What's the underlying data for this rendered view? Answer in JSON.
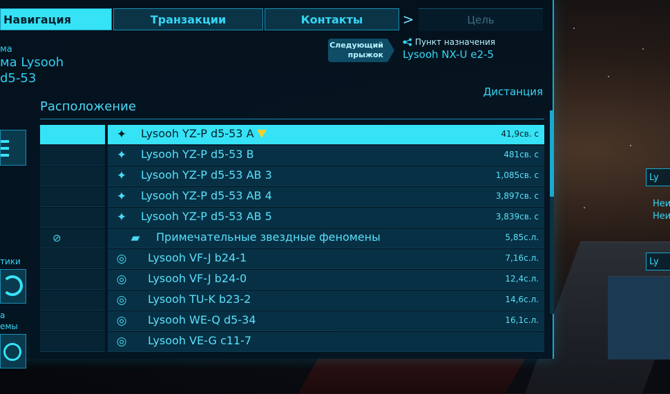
{
  "tabs": {
    "navigation": "Навигация",
    "transactions": "Транзакции",
    "contacts": "Контакты",
    "next_arrow": ">",
    "goal": "Цель"
  },
  "system": {
    "line1": "ма",
    "line2": "ма Lysooh",
    "line3": "d5-53"
  },
  "next_jump": {
    "label_line1": "Следующий",
    "label_line2": "прыжок",
    "dest_title": "Пункт назначения",
    "dest_value": "Lysooh NX-U e2-5"
  },
  "list_header": {
    "location": "Расположение",
    "distance": "Дистанция"
  },
  "left_panel": {
    "label1": "тики",
    "label2": "а",
    "label3": "емы"
  },
  "rows": [
    {
      "icon": "star-icon",
      "name": "Lysooh YZ-P d5-53 A",
      "distance": "41,9св. с",
      "selected": true,
      "marker": true
    },
    {
      "icon": "star-icon",
      "name": "Lysooh YZ-P d5-53 B",
      "distance": "481св. с"
    },
    {
      "icon": "star-icon",
      "name": "Lysooh YZ-P d5-53 AB 3",
      "distance": "1,085св. с"
    },
    {
      "icon": "star-icon",
      "name": "Lysooh YZ-P d5-53 AB 4",
      "distance": "3,897св. с"
    },
    {
      "icon": "star-icon",
      "name": "Lysooh YZ-P d5-53 AB 5",
      "distance": "3,839св. с"
    },
    {
      "icon": "codex-icon",
      "name": "Примечательные звездные феномены",
      "distance": "5,85с.л.",
      "left_icon": true
    },
    {
      "icon": "system-icon",
      "name": "Lysooh VF-J b24-1",
      "distance": "7,16с.л."
    },
    {
      "icon": "system-icon",
      "name": "Lysooh VF-J b24-0",
      "distance": "12,4с.л."
    },
    {
      "icon": "system-icon",
      "name": "Lysooh TU-K b23-2",
      "distance": "14,6с.л."
    },
    {
      "icon": "system-icon",
      "name": "Lysooh WE-Q d5-34",
      "distance": "16,1с.л."
    },
    {
      "icon": "system-icon",
      "name": "Lysooh VE-G c11-7",
      "distance": ""
    }
  ],
  "right_hud": {
    "item1": "Ly",
    "item2": "Неи",
    "item3": "Неи",
    "item4": "Ly"
  },
  "colors": {
    "accent": "#36e3f6",
    "panel_bg": "#062433",
    "marker": "#f2d130"
  }
}
